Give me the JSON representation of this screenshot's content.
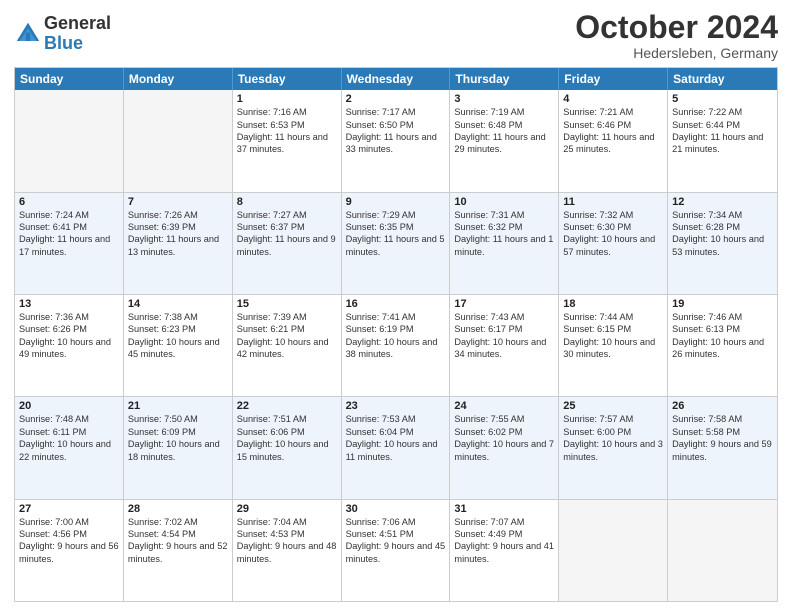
{
  "logo": {
    "general": "General",
    "blue": "Blue"
  },
  "title": "October 2024",
  "subtitle": "Hedersleben, Germany",
  "days": [
    "Sunday",
    "Monday",
    "Tuesday",
    "Wednesday",
    "Thursday",
    "Friday",
    "Saturday"
  ],
  "rows": [
    [
      {
        "day": "",
        "content": "",
        "empty": true
      },
      {
        "day": "",
        "content": "",
        "empty": true
      },
      {
        "day": "1",
        "content": "Sunrise: 7:16 AM\nSunset: 6:53 PM\nDaylight: 11 hours and 37 minutes.",
        "empty": false
      },
      {
        "day": "2",
        "content": "Sunrise: 7:17 AM\nSunset: 6:50 PM\nDaylight: 11 hours and 33 minutes.",
        "empty": false
      },
      {
        "day": "3",
        "content": "Sunrise: 7:19 AM\nSunset: 6:48 PM\nDaylight: 11 hours and 29 minutes.",
        "empty": false
      },
      {
        "day": "4",
        "content": "Sunrise: 7:21 AM\nSunset: 6:46 PM\nDaylight: 11 hours and 25 minutes.",
        "empty": false
      },
      {
        "day": "5",
        "content": "Sunrise: 7:22 AM\nSunset: 6:44 PM\nDaylight: 11 hours and 21 minutes.",
        "empty": false
      }
    ],
    [
      {
        "day": "6",
        "content": "Sunrise: 7:24 AM\nSunset: 6:41 PM\nDaylight: 11 hours and 17 minutes.",
        "empty": false
      },
      {
        "day": "7",
        "content": "Sunrise: 7:26 AM\nSunset: 6:39 PM\nDaylight: 11 hours and 13 minutes.",
        "empty": false
      },
      {
        "day": "8",
        "content": "Sunrise: 7:27 AM\nSunset: 6:37 PM\nDaylight: 11 hours and 9 minutes.",
        "empty": false
      },
      {
        "day": "9",
        "content": "Sunrise: 7:29 AM\nSunset: 6:35 PM\nDaylight: 11 hours and 5 minutes.",
        "empty": false
      },
      {
        "day": "10",
        "content": "Sunrise: 7:31 AM\nSunset: 6:32 PM\nDaylight: 11 hours and 1 minute.",
        "empty": false
      },
      {
        "day": "11",
        "content": "Sunrise: 7:32 AM\nSunset: 6:30 PM\nDaylight: 10 hours and 57 minutes.",
        "empty": false
      },
      {
        "day": "12",
        "content": "Sunrise: 7:34 AM\nSunset: 6:28 PM\nDaylight: 10 hours and 53 minutes.",
        "empty": false
      }
    ],
    [
      {
        "day": "13",
        "content": "Sunrise: 7:36 AM\nSunset: 6:26 PM\nDaylight: 10 hours and 49 minutes.",
        "empty": false
      },
      {
        "day": "14",
        "content": "Sunrise: 7:38 AM\nSunset: 6:23 PM\nDaylight: 10 hours and 45 minutes.",
        "empty": false
      },
      {
        "day": "15",
        "content": "Sunrise: 7:39 AM\nSunset: 6:21 PM\nDaylight: 10 hours and 42 minutes.",
        "empty": false
      },
      {
        "day": "16",
        "content": "Sunrise: 7:41 AM\nSunset: 6:19 PM\nDaylight: 10 hours and 38 minutes.",
        "empty": false
      },
      {
        "day": "17",
        "content": "Sunrise: 7:43 AM\nSunset: 6:17 PM\nDaylight: 10 hours and 34 minutes.",
        "empty": false
      },
      {
        "day": "18",
        "content": "Sunrise: 7:44 AM\nSunset: 6:15 PM\nDaylight: 10 hours and 30 minutes.",
        "empty": false
      },
      {
        "day": "19",
        "content": "Sunrise: 7:46 AM\nSunset: 6:13 PM\nDaylight: 10 hours and 26 minutes.",
        "empty": false
      }
    ],
    [
      {
        "day": "20",
        "content": "Sunrise: 7:48 AM\nSunset: 6:11 PM\nDaylight: 10 hours and 22 minutes.",
        "empty": false
      },
      {
        "day": "21",
        "content": "Sunrise: 7:50 AM\nSunset: 6:09 PM\nDaylight: 10 hours and 18 minutes.",
        "empty": false
      },
      {
        "day": "22",
        "content": "Sunrise: 7:51 AM\nSunset: 6:06 PM\nDaylight: 10 hours and 15 minutes.",
        "empty": false
      },
      {
        "day": "23",
        "content": "Sunrise: 7:53 AM\nSunset: 6:04 PM\nDaylight: 10 hours and 11 minutes.",
        "empty": false
      },
      {
        "day": "24",
        "content": "Sunrise: 7:55 AM\nSunset: 6:02 PM\nDaylight: 10 hours and 7 minutes.",
        "empty": false
      },
      {
        "day": "25",
        "content": "Sunrise: 7:57 AM\nSunset: 6:00 PM\nDaylight: 10 hours and 3 minutes.",
        "empty": false
      },
      {
        "day": "26",
        "content": "Sunrise: 7:58 AM\nSunset: 5:58 PM\nDaylight: 9 hours and 59 minutes.",
        "empty": false
      }
    ],
    [
      {
        "day": "27",
        "content": "Sunrise: 7:00 AM\nSunset: 4:56 PM\nDaylight: 9 hours and 56 minutes.",
        "empty": false
      },
      {
        "day": "28",
        "content": "Sunrise: 7:02 AM\nSunset: 4:54 PM\nDaylight: 9 hours and 52 minutes.",
        "empty": false
      },
      {
        "day": "29",
        "content": "Sunrise: 7:04 AM\nSunset: 4:53 PM\nDaylight: 9 hours and 48 minutes.",
        "empty": false
      },
      {
        "day": "30",
        "content": "Sunrise: 7:06 AM\nSunset: 4:51 PM\nDaylight: 9 hours and 45 minutes.",
        "empty": false
      },
      {
        "day": "31",
        "content": "Sunrise: 7:07 AM\nSunset: 4:49 PM\nDaylight: 9 hours and 41 minutes.",
        "empty": false
      },
      {
        "day": "",
        "content": "",
        "empty": true
      },
      {
        "day": "",
        "content": "",
        "empty": true
      }
    ]
  ]
}
